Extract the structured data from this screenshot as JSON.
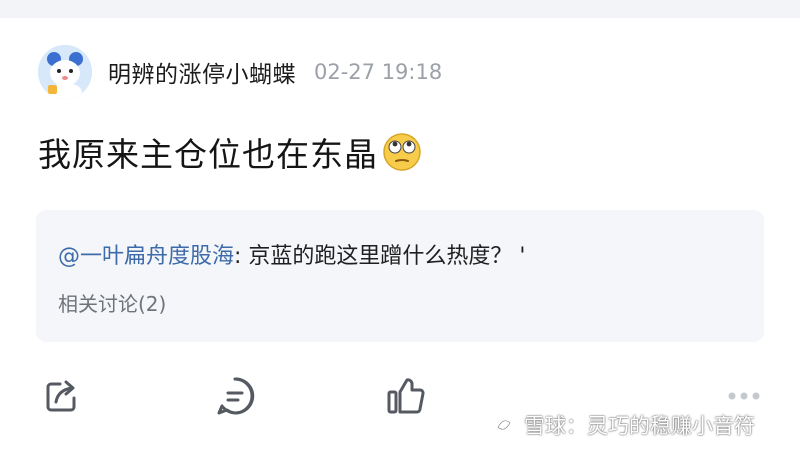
{
  "post": {
    "author": "明辨的涨停小蝴蝶",
    "timestamp": "02-27 19:18",
    "text": "我原来主仓位也在东晶",
    "emoji": "rolling-eyes-emoji"
  },
  "quote": {
    "author": "@一叶扁舟度股海",
    "separator": ": ",
    "body": "京蓝的跑这里蹭什么热度？ '",
    "discussion": "相关讨论(2)"
  },
  "actions": {
    "icons": [
      "share-icon",
      "comment-icon",
      "like-icon",
      "more-icon"
    ]
  },
  "watermark": {
    "text": "雪球：灵巧的稳赚小音符"
  },
  "colors": {
    "link": "#3d6aa8",
    "muted": "#9ca0a8",
    "card": "#f4f6fa"
  }
}
